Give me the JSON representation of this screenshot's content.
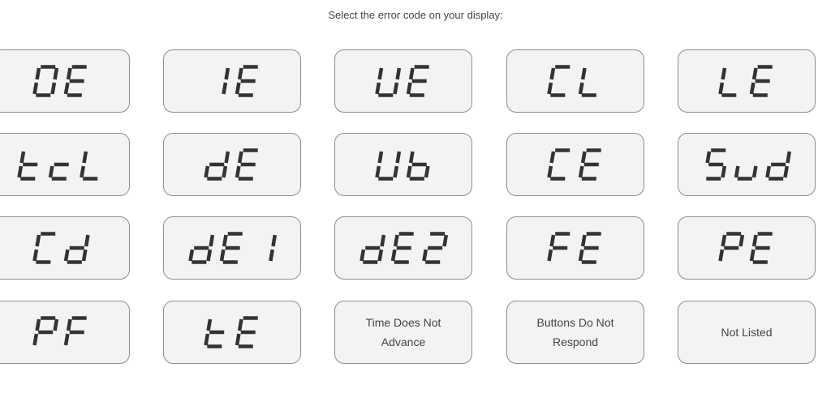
{
  "prompt": "Select the error code on your display:",
  "codes": [
    {
      "label": "OE",
      "kind": "lcd"
    },
    {
      "label": "IE",
      "kind": "lcd"
    },
    {
      "label": "UE",
      "kind": "lcd"
    },
    {
      "label": "CL",
      "kind": "lcd"
    },
    {
      "label": "LE",
      "kind": "lcd"
    },
    {
      "label": "tcL",
      "kind": "lcd"
    },
    {
      "label": "dE",
      "kind": "lcd"
    },
    {
      "label": "Ub",
      "kind": "lcd"
    },
    {
      "label": "CE",
      "kind": "lcd"
    },
    {
      "label": "Sud",
      "kind": "lcd"
    },
    {
      "label": "Cd",
      "kind": "lcd"
    },
    {
      "label": "dE1",
      "kind": "lcd"
    },
    {
      "label": "dE2",
      "kind": "lcd"
    },
    {
      "label": "FE",
      "kind": "lcd"
    },
    {
      "label": "PE",
      "kind": "lcd"
    },
    {
      "label": "PF",
      "kind": "lcd"
    },
    {
      "label": "tE",
      "kind": "lcd"
    },
    {
      "label": "Time Does Not Advance",
      "kind": "text"
    },
    {
      "label": "Buttons Do Not Respond",
      "kind": "text"
    },
    {
      "label": "Not Listed",
      "kind": "text"
    }
  ]
}
